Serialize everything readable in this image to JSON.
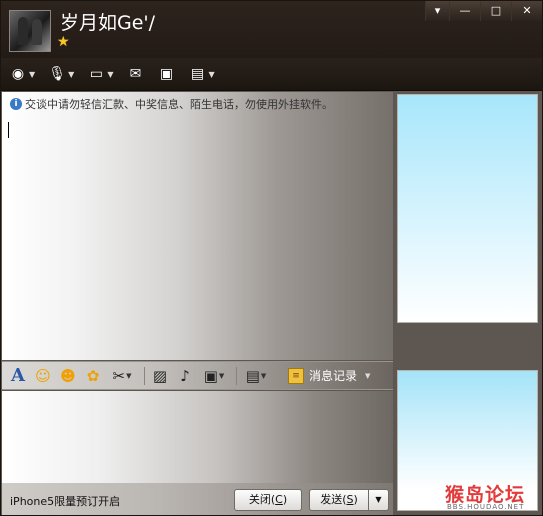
{
  "window": {
    "nickname": "岁月如Ge'/",
    "controls": [
      "▾",
      "—",
      "□",
      "✕"
    ]
  },
  "toolbar": {
    "items": [
      {
        "name": "video-call",
        "glyph": "◉",
        "dropdown": true
      },
      {
        "name": "voice-call",
        "glyph": "🎤",
        "dropdown": true
      },
      {
        "name": "transfer-file",
        "glyph": "📁",
        "dropdown": true
      },
      {
        "name": "sms",
        "glyph": "✉",
        "dropdown": false
      },
      {
        "name": "remote-desktop",
        "glyph": "▣",
        "dropdown": false
      },
      {
        "name": "apps",
        "glyph": "▤",
        "dropdown": true
      }
    ]
  },
  "notice": {
    "text": "交谈中请勿轻信汇款、中奖信息、陌生电话，勿使用外挂软件。"
  },
  "format_toolbar": {
    "font_label": "A",
    "history_label": "消息记录"
  },
  "bottom": {
    "promo": "iPhone5限量预订开启",
    "close_label": "关闭(",
    "close_key": "C",
    "send_label": "发送(",
    "send_key": "S",
    "send_dropdown": "▼"
  },
  "watermark": {
    "text": "猴岛论坛",
    "sub": "BBS.HOUDAO.NET"
  },
  "colors": {
    "titlebar": "#2a211b",
    "accent_blue": "#3a79c6",
    "panel_sky": "#a7e6fb"
  }
}
